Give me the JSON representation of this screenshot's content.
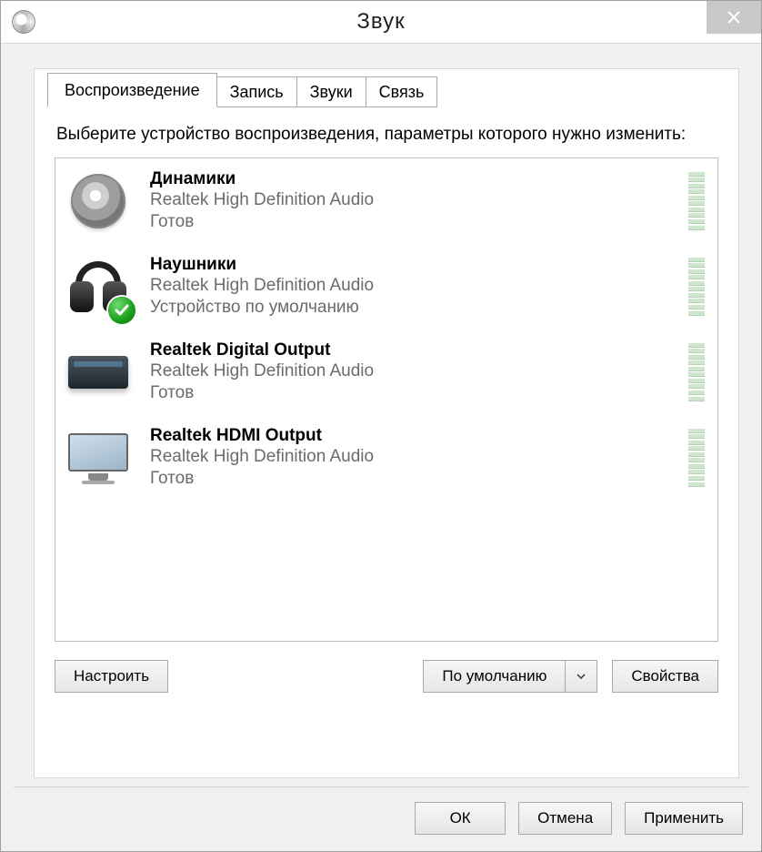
{
  "window": {
    "title": "Звук"
  },
  "tabs": [
    {
      "label": "Воспроизведение",
      "active": true
    },
    {
      "label": "Запись",
      "active": false
    },
    {
      "label": "Звуки",
      "active": false
    },
    {
      "label": "Связь",
      "active": false
    }
  ],
  "instruction": "Выберите устройство воспроизведения, параметры которого нужно изменить:",
  "devices": [
    {
      "icon": "speaker",
      "name": "Динамики",
      "desc": "Realtek High Definition Audio",
      "status": "Готов",
      "default": false
    },
    {
      "icon": "headphones",
      "name": "Наушники",
      "desc": "Realtek High Definition Audio",
      "status": "Устройство по умолчанию",
      "default": true
    },
    {
      "icon": "digital",
      "name": "Realtek Digital Output",
      "desc": "Realtek High Definition Audio",
      "status": "Готов",
      "default": false
    },
    {
      "icon": "hdmi",
      "name": "Realtek HDMI Output",
      "desc": "Realtek High Definition Audio",
      "status": "Готов",
      "default": false
    }
  ],
  "buttons": {
    "configure": "Настроить",
    "setdefault": "По умолчанию",
    "properties": "Свойства",
    "ok": "ОК",
    "cancel": "Отмена",
    "apply": "Применить"
  }
}
